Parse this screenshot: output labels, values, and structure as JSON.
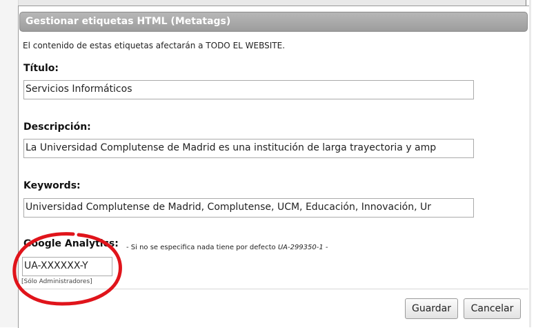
{
  "dialog": {
    "title": "Gestionar etiquetas HTML (Metatags)",
    "intro": "El contenido de estas etiquetas afectarán a TODO EL WEBSITE."
  },
  "fields": {
    "titulo": {
      "label": "Título:",
      "value": "Servicios Informáticos"
    },
    "descripcion": {
      "label": "Descripción:",
      "value": "La Universidad Complutense de Madrid es una institución de larga trayectoria y amp"
    },
    "keywords": {
      "label": "Keywords:",
      "value": "Universidad Complutense de Madrid, Complutense, UCM, Educación, Innovación, Ur"
    },
    "analytics": {
      "label": "Google Analytics:",
      "note_prefix": "- Si no se especifica nada tiene por defecto",
      "note_default": "UA-299350-1",
      "note_suffix": "-",
      "value": "UA-XXXXXX-Y",
      "admin_note": "[Sólo Administradores]"
    }
  },
  "buttons": {
    "save": "Guardar",
    "cancel": "Cancelar"
  },
  "colors": {
    "annotation_circle": "#e0141b",
    "titlebar": "#a9a9a9"
  }
}
